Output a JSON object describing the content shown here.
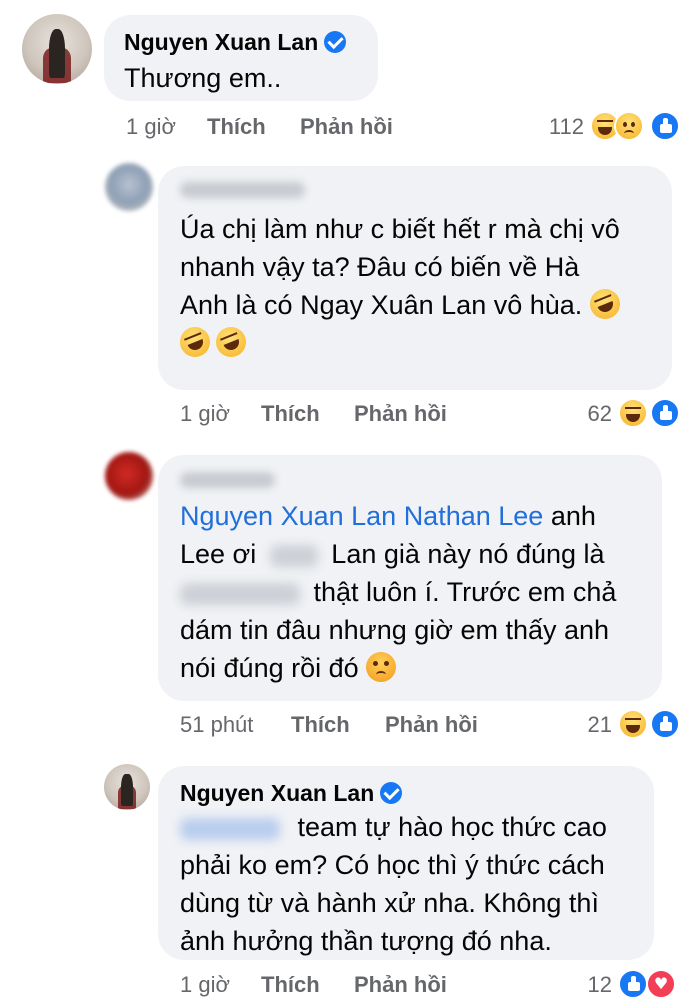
{
  "comments": [
    {
      "author": "Nguyen Xuan Lan",
      "verified": true,
      "text": "Thương em..",
      "time": "1 giờ",
      "like_label": "Thích",
      "reply_label": "Phản hồi",
      "reaction_count": "112",
      "reactions": [
        "haha-reaction-icon",
        "sad-reaction-icon",
        "like-reaction-icon"
      ]
    },
    {
      "author_redacted": true,
      "text_line1": "Úa chị làm như c biết hết r mà chị vô",
      "text_line2": "nhanh vậy ta? Đâu có biến về Hà",
      "text_line3": "Anh là có Ngay Xuân Lan vô hùa.",
      "emojis": [
        "rolling-laughing-emoji",
        "rolling-laughing-emoji",
        "rolling-laughing-emoji"
      ],
      "time": "1 giờ",
      "like_label": "Thích",
      "reply_label": "Phản hồi",
      "reaction_count": "62",
      "reactions": [
        "haha-reaction-icon",
        "like-reaction-icon"
      ]
    },
    {
      "author_redacted": true,
      "mention1": "Nguyen Xuan Lan",
      "mention2": "Nathan Lee",
      "text_after_mentions": "anh",
      "text_line2_a": "Lee ơi",
      "text_line2_b": "Lan già này nó đúng là",
      "text_line3_b": "thật luôn í. Trước em chả",
      "text_line4": "dám tin đâu nhưng giờ em thấy anh",
      "text_line5": "nói đúng rồi đó",
      "emojis": [
        "angry-emoji"
      ],
      "time": "51 phút",
      "like_label": "Thích",
      "reply_label": "Phản hồi",
      "reaction_count": "21",
      "reactions": [
        "haha-reaction-icon",
        "like-reaction-icon"
      ]
    },
    {
      "author": "Nguyen Xuan Lan",
      "verified": true,
      "text_line1_b": "team tự hào học thức cao",
      "text_line2": "phải ko em? Có học thì ý thức cách",
      "text_line3": "dùng từ và hành xử nha. Không thì",
      "text_line4": "ảnh hưởng thần tượng đó nha.",
      "time": "1 giờ",
      "like_label": "Thích",
      "reply_label": "Phản hồi",
      "reaction_count": "12",
      "reactions": [
        "like-reaction-icon",
        "love-reaction-icon"
      ]
    }
  ],
  "colors": {
    "bubble": "#f0f2f5",
    "meta_text": "#65676b",
    "mention": "#216fdb",
    "verified": "#1877f2"
  }
}
